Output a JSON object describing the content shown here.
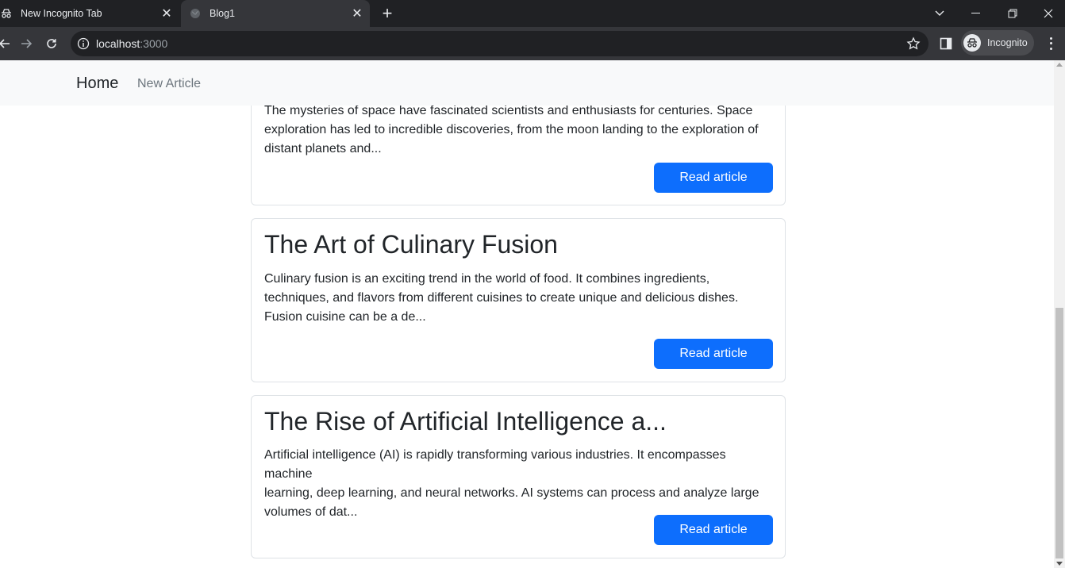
{
  "browser": {
    "tabs": [
      {
        "title": "New Incognito Tab",
        "icon": "incognito-icon"
      },
      {
        "title": "Blog1",
        "icon": "globe-icon"
      }
    ],
    "address": {
      "host": "localhost",
      "port": ":3000"
    },
    "profile_label": "Incognito"
  },
  "navbar": {
    "brand": "Home",
    "links": [
      "New Article"
    ]
  },
  "articles": [
    {
      "title": "",
      "excerpt_lines": [
        "The mysteries of space have fascinated scientists and enthusiasts for centuries. Space",
        "exploration has led to incredible discoveries, from the moon landing to the exploration of",
        "distant planets and..."
      ],
      "button": "Read article"
    },
    {
      "title": "The Art of Culinary Fusion",
      "excerpt_lines": [
        "Culinary fusion is an exciting trend in the world of food. It combines ingredients,",
        "techniques, and flavors from different cuisines to create unique and delicious dishes.",
        "Fusion cuisine can be a de..."
      ],
      "button": "Read article"
    },
    {
      "title": "The Rise of Artificial Intelligence a...",
      "excerpt_lines": [
        "Artificial intelligence (AI) is rapidly transforming various industries. It encompasses machine",
        "learning, deep learning, and neural networks. AI systems can process and analyze large",
        "volumes of dat..."
      ],
      "button": "Read article"
    }
  ],
  "colors": {
    "primary": "#0d6efd",
    "navbar_bg": "#f8f9fa",
    "chrome_dark": "#202124",
    "chrome_toolbar": "#35363a"
  }
}
